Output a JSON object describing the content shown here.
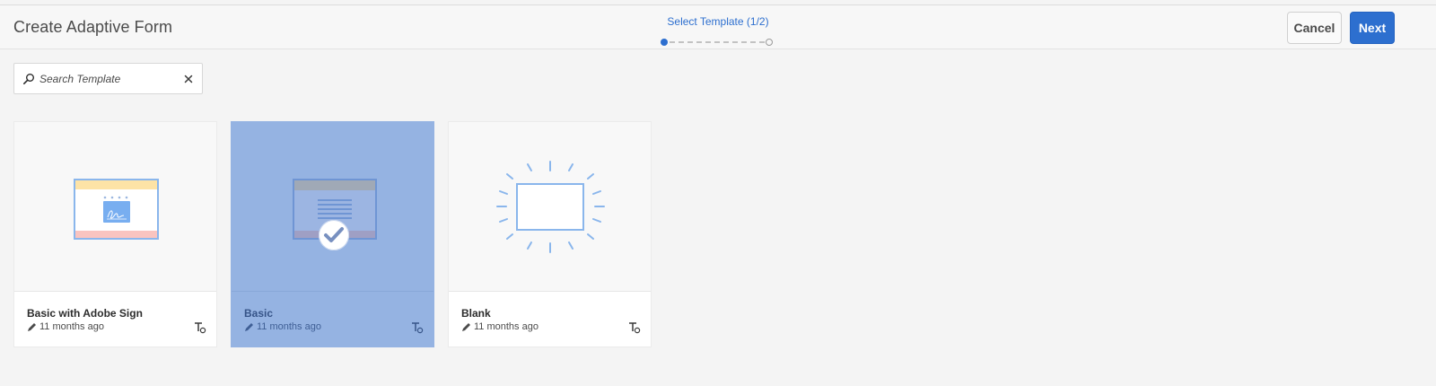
{
  "header": {
    "title": "Create Adaptive Form",
    "wizard": {
      "step_label": "Select Template (1/2)",
      "current_step": 1,
      "total_steps": 2
    },
    "cancel_label": "Cancel",
    "next_label": "Next"
  },
  "search": {
    "placeholder": "Search Template",
    "value": ""
  },
  "templates": [
    {
      "title": "Basic with Adobe Sign",
      "modified": "11 months ago",
      "selected": false,
      "thumbnail": "adobe-sign-form-icon"
    },
    {
      "title": "Basic",
      "modified": "11 months ago",
      "selected": true,
      "thumbnail": "basic-form-icon"
    },
    {
      "title": "Blank",
      "modified": "11 months ago",
      "selected": false,
      "thumbnail": "blank-form-icon"
    }
  ],
  "colors": {
    "accent": "#2d6fcf",
    "selected_card": "#95b3e2",
    "background": "#f4f4f4"
  }
}
